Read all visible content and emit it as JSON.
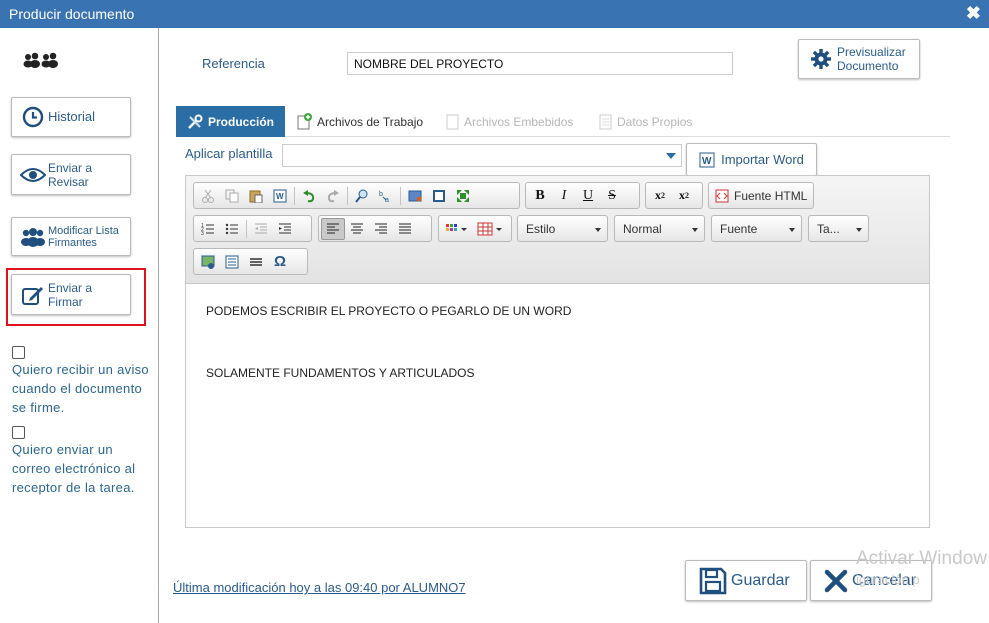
{
  "window": {
    "title": "Producir documento"
  },
  "sidebar": {
    "historial": "Historial",
    "enviar_revisar": [
      "Enviar a",
      "Revisar"
    ],
    "modificar_lista": [
      "Modificar Lista",
      "Firmantes"
    ],
    "enviar_firmar": [
      "Enviar a",
      "Firmar"
    ],
    "check1": [
      "Quiero recibir un aviso",
      "cuando el documento",
      "se firme."
    ],
    "check2": [
      "Quiero enviar un",
      "correo electrónico al",
      "receptor de la tarea."
    ]
  },
  "main": {
    "ref_label": "Referencia",
    "ref_value": "NOMBRE DEL PROYECTO",
    "preview": [
      "Previsualizar",
      "Documento"
    ],
    "tabs": [
      {
        "label": "Producción",
        "state": "active"
      },
      {
        "label": "Archivos de Trabajo",
        "state": "normal"
      },
      {
        "label": "Archivos Embebidos",
        "state": "disabled"
      },
      {
        "label": "Datos Propios",
        "state": "disabled"
      }
    ],
    "template_label": "Aplicar plantilla",
    "template_value": "",
    "import_word": "Importar Word"
  },
  "editor": {
    "source_html": "Fuente HTML",
    "combo_style": "Estilo",
    "combo_format": "Normal",
    "combo_font": "Fuente",
    "combo_size": "Ta...",
    "content_lines": [
      "PODEMOS ESCRIBIR EL PROYECTO O PEGARLO DE UN WORD",
      "SOLAMENTE FUNDAMENTOS Y ARTICULADOS"
    ]
  },
  "footer": {
    "last_modified": "Última modificación hoy a las 09:40 por ALUMNO7",
    "save": "Guardar",
    "cancel": "Cancelar"
  },
  "watermark": {
    "line1": "Activar Window",
    "line2": "iguración p"
  },
  "colors": {
    "titlebar": "#3a73b1",
    "accent": "#2a6ea5",
    "highlight": "#e0101d",
    "link": "#2a5b8c"
  }
}
